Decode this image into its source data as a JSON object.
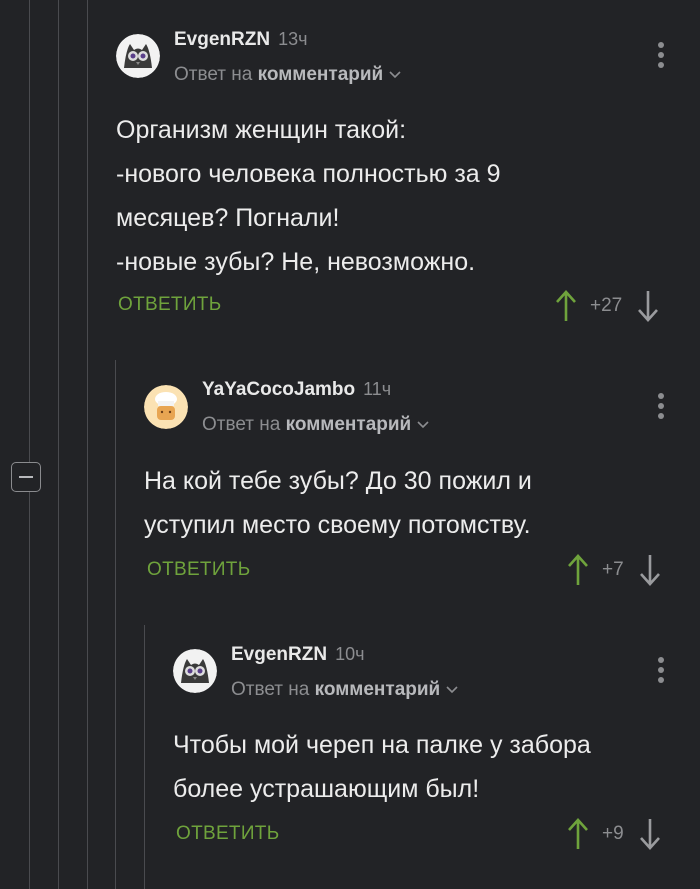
{
  "comments": [
    {
      "author": "EvgenRZN",
      "time": "13ч",
      "reply_prefix": "Ответ на",
      "reply_target": "комментарий",
      "lines": [
        "Организм женщин такой:",
        "-нового человека полностью за 9",
        "месяцев? Погнали!",
        "-новые зубы? Не, невозможно."
      ],
      "reply_label": "ОТВЕТИТЬ",
      "rating": "+27",
      "avatar_icon": "owl-avatar-icon"
    },
    {
      "author": "YaYaCocoJambo",
      "time": "11ч",
      "reply_prefix": "Ответ на",
      "reply_target": "комментарий",
      "lines": [
        "На кой тебе зубы? До 30 пожил и",
        "уступил место своему потомству."
      ],
      "reply_label": "ОТВЕТИТЬ",
      "rating": "+7",
      "avatar_icon": "chef-avatar-icon"
    },
    {
      "author": "EvgenRZN",
      "time": "10ч",
      "reply_prefix": "Ответ на",
      "reply_target": "комментарий",
      "lines": [
        "Чтобы мой череп на палке у забора",
        "более устрашающим был!"
      ],
      "reply_label": "ОТВЕТИТЬ",
      "rating": "+9",
      "avatar_icon": "owl-avatar-icon"
    }
  ],
  "colors": {
    "background": "#222326",
    "accent_green": "#6fa33c",
    "muted": "#8c8d90"
  }
}
